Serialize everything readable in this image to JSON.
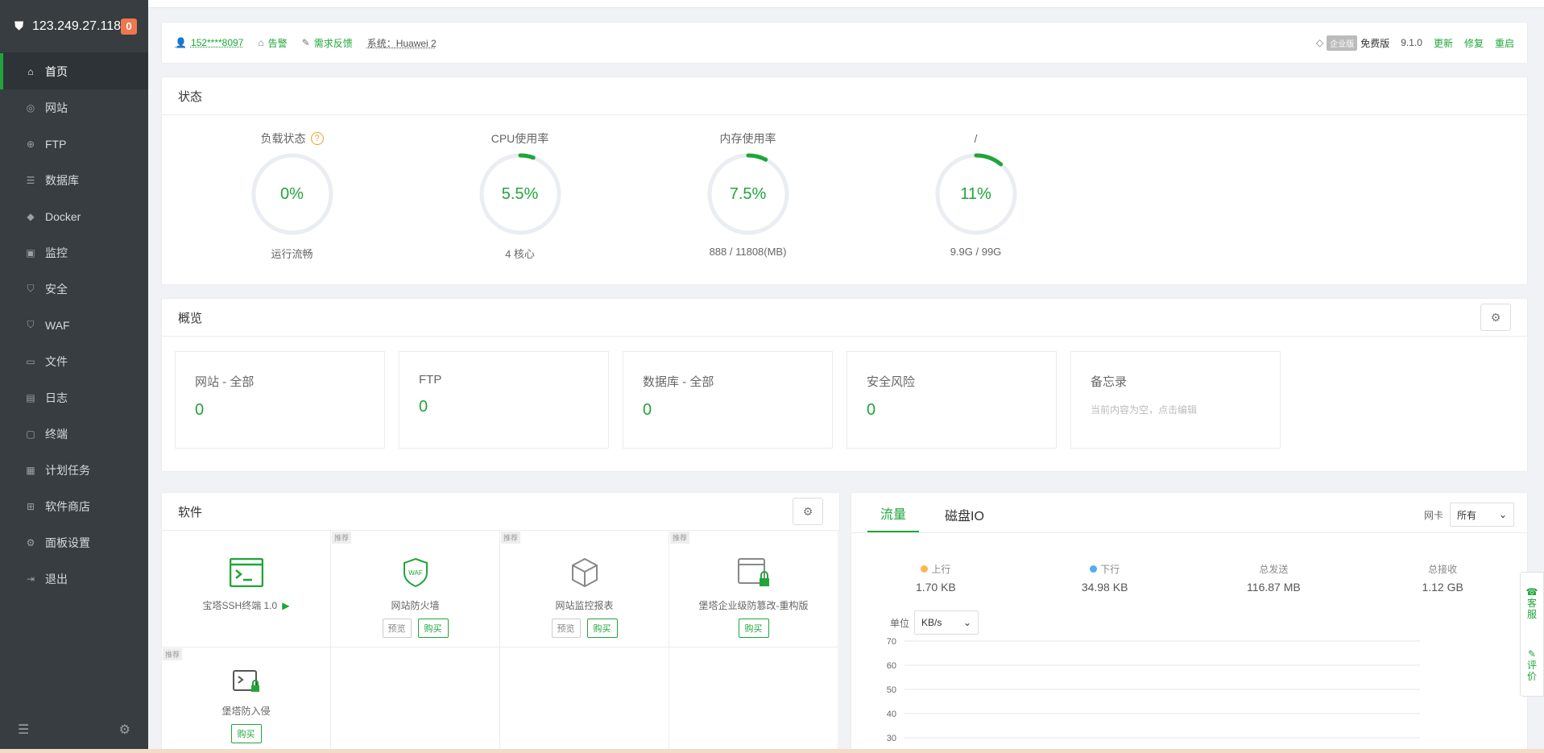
{
  "sidebar": {
    "server_ip": "123.249.27.118",
    "badge": "0",
    "items": [
      {
        "label": "首页",
        "icon": "home-icon"
      },
      {
        "label": "网站",
        "icon": "globe-icon"
      },
      {
        "label": "FTP",
        "icon": "globe-icon"
      },
      {
        "label": "数据库",
        "icon": "database-icon"
      },
      {
        "label": "Docker",
        "icon": "docker-icon"
      },
      {
        "label": "监控",
        "icon": "monitor-icon"
      },
      {
        "label": "安全",
        "icon": "shield-icon"
      },
      {
        "label": "WAF",
        "icon": "shield-icon"
      },
      {
        "label": "文件",
        "icon": "folder-icon"
      },
      {
        "label": "日志",
        "icon": "log-icon"
      },
      {
        "label": "终端",
        "icon": "terminal-icon"
      },
      {
        "label": "计划任务",
        "icon": "calendar-icon"
      },
      {
        "label": "软件商店",
        "icon": "grid-icon"
      },
      {
        "label": "面板设置",
        "icon": "gear-icon"
      },
      {
        "label": "退出",
        "icon": "exit-icon"
      }
    ]
  },
  "topbar": {
    "user": "152****8097",
    "alert": "告警",
    "feedback": "需求反馈",
    "system": "系统：Huawei 2",
    "enterprise_tag": "企业版",
    "free_label": "免费版",
    "version": "9.1.0",
    "update": "更新",
    "repair": "修复",
    "restart": "重启"
  },
  "status": {
    "title": "状态",
    "gauges": [
      {
        "title": "负载状态",
        "value": "0%",
        "percent": 0,
        "sub": "运行流畅",
        "help": "?"
      },
      {
        "title": "CPU使用率",
        "value": "5.5%",
        "percent": 5.5,
        "sub": "4 核心"
      },
      {
        "title": "内存使用率",
        "value": "7.5%",
        "percent": 7.5,
        "sub": "888 / 11808(MB)"
      },
      {
        "title": "/",
        "value": "11%",
        "percent": 11,
        "sub": "9.9G / 99G"
      }
    ]
  },
  "overview": {
    "title": "概览",
    "boxes": [
      {
        "name": "网站 - 全部",
        "value": "0"
      },
      {
        "name": "FTP",
        "value": "0"
      },
      {
        "name": "数据库 - 全部",
        "value": "0"
      },
      {
        "name": "安全风险",
        "value": "0"
      }
    ],
    "memo": {
      "name": "备忘录",
      "placeholder": "当前内容为空，点击编辑"
    }
  },
  "software": {
    "title": "软件",
    "rec_label": "推荐",
    "preview": "预览",
    "buy": "购买",
    "items": [
      {
        "name": "宝塔SSH终端 1.0"
      },
      {
        "name": "网站防火墙"
      },
      {
        "name": "网站监控报表"
      },
      {
        "name": "堡塔企业级防篡改-重构版"
      },
      {
        "name": "堡塔防入侵"
      }
    ]
  },
  "traffic": {
    "tabs": [
      "流量",
      "磁盘IO"
    ],
    "nic_label": "网卡",
    "nic_value": "所有",
    "stats": [
      {
        "label": "上行",
        "value": "1.70 KB",
        "color": "#f7b851"
      },
      {
        "label": "下行",
        "value": "34.98 KB",
        "color": "#52a9ff"
      },
      {
        "label": "总发送",
        "value": "116.87 MB"
      },
      {
        "label": "总接收",
        "value": "1.12 GB"
      }
    ],
    "unit_label": "单位",
    "unit_value": "KB/s",
    "y_ticks": [
      "70",
      "60",
      "50",
      "40",
      "30"
    ]
  },
  "float_panel": {
    "service": "客服",
    "review": "评价"
  },
  "colors": {
    "accent": "#20a53a",
    "sidebar_bg": "#373d41",
    "badge": "#f0774d"
  }
}
